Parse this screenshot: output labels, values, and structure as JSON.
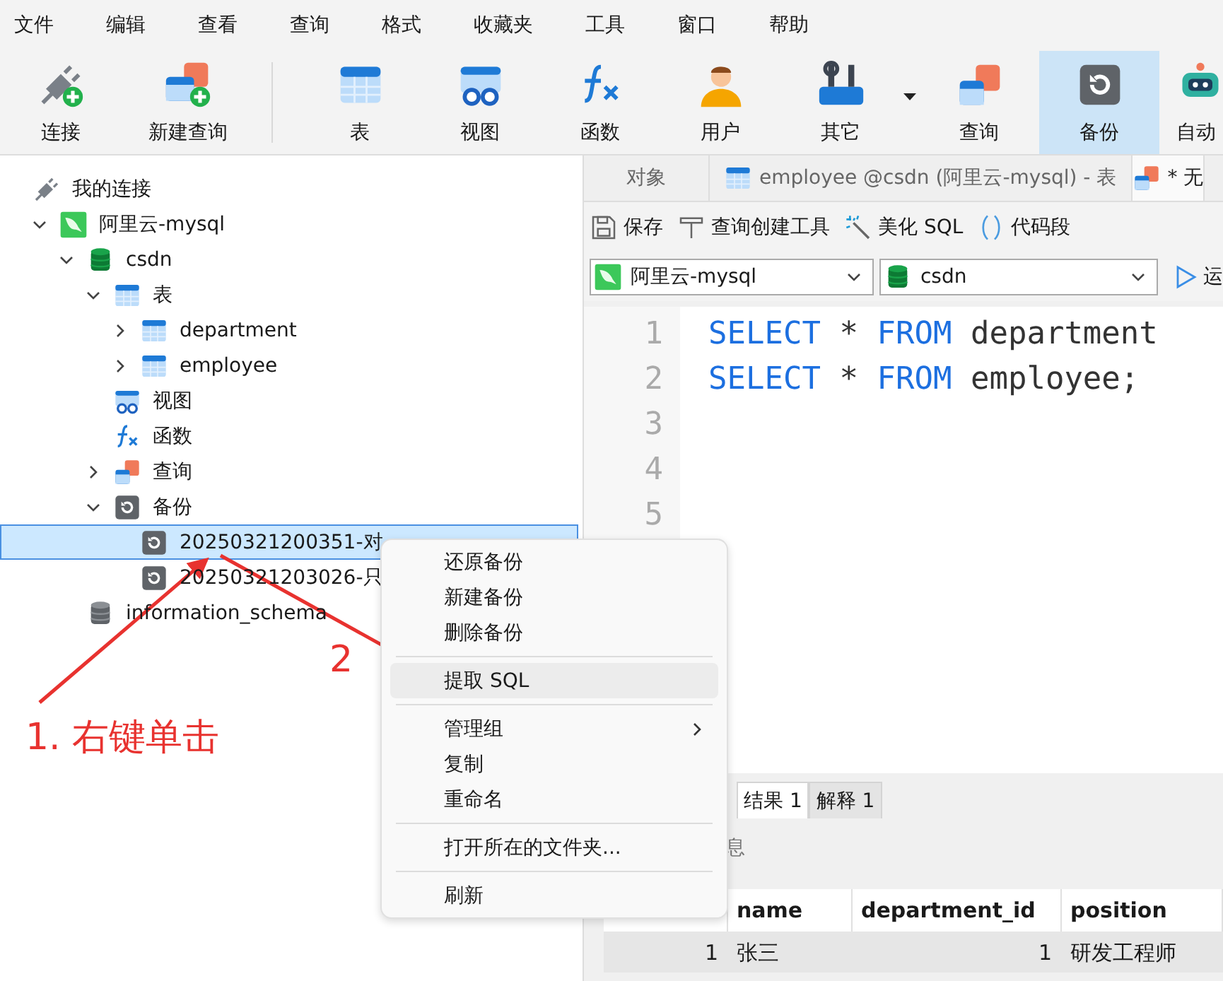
{
  "menu_bar": [
    "文件",
    "编辑",
    "查看",
    "查询",
    "格式",
    "收藏夹",
    "工具",
    "窗口",
    "帮助"
  ],
  "toolbar": [
    {
      "label": "连接",
      "kind": "plug",
      "selected": false
    },
    {
      "label": "新建查询",
      "kind": "newquery",
      "selected": false
    },
    {
      "label": "表",
      "kind": "table",
      "selected": false
    },
    {
      "label": "视图",
      "kind": "view",
      "selected": false
    },
    {
      "label": "函数",
      "kind": "function",
      "selected": false
    },
    {
      "label": "用户",
      "kind": "user",
      "selected": false
    },
    {
      "label": "其它",
      "kind": "tools",
      "selected": false,
      "dropdown": true
    },
    {
      "label": "查询",
      "kind": "query",
      "selected": false
    },
    {
      "label": "备份",
      "kind": "backup",
      "selected": true
    },
    {
      "label": "自动",
      "kind": "robot",
      "selected": false
    }
  ],
  "sidebar": {
    "root_label": "我的连接",
    "tree": [
      {
        "label": "阿里云-mysql",
        "kind": "mysql",
        "expanded": true,
        "selected": false,
        "children": [
          {
            "label": "csdn",
            "kind": "db",
            "expanded": true,
            "selected": false,
            "children": [
              {
                "label": "表",
                "kind": "table",
                "expanded": true,
                "selected": false,
                "children": [
                  {
                    "label": "department",
                    "kind": "table",
                    "expanded": false,
                    "selected": false
                  },
                  {
                    "label": "employee",
                    "kind": "table",
                    "expanded": false,
                    "selected": false
                  }
                ]
              },
              {
                "label": "视图",
                "kind": "view",
                "selected": false
              },
              {
                "label": "函数",
                "kind": "function",
                "selected": false
              },
              {
                "label": "查询",
                "kind": "query",
                "expanded": false,
                "selected": false
              },
              {
                "label": "备份",
                "kind": "backup",
                "expanded": true,
                "selected": false,
                "children": [
                  {
                    "label": "20250321200351-对",
                    "kind": "backup",
                    "selected": true
                  },
                  {
                    "label": "20250321203026-只",
                    "kind": "backup",
                    "selected": false
                  }
                ]
              }
            ]
          },
          {
            "label": "information_schema",
            "kind": "dbgrey",
            "selected": false
          }
        ]
      }
    ]
  },
  "tabs": [
    {
      "label": "对象",
      "kind": "plain",
      "selected": false
    },
    {
      "label": "employee @csdn (阿里云-mysql) - 表",
      "kind": "table",
      "selected": false
    },
    {
      "label": "* 无",
      "kind": "query",
      "selected": true
    }
  ],
  "editor_toolbar": [
    "保存",
    "查询创建工具",
    "美化 SQL",
    "代码段"
  ],
  "connection_select": "阿里云-mysql",
  "database_select": "csdn",
  "run_button": "运",
  "editor": {
    "line_numbers": [
      "1",
      "2",
      "3",
      "4",
      "5"
    ],
    "lines": [
      [
        {
          "text": "SELECT",
          "kind": "keyword"
        },
        {
          "text": " * ",
          "kind": "plain"
        },
        {
          "text": "FROM",
          "kind": "keyword"
        },
        {
          "text": " department",
          "kind": "plain"
        }
      ],
      [
        {
          "text": "SELECT",
          "kind": "keyword"
        },
        {
          "text": " * ",
          "kind": "plain"
        },
        {
          "text": "FROM",
          "kind": "keyword"
        },
        {
          "text": " employee;",
          "kind": "plain"
        }
      ]
    ]
  },
  "result_tabs": [
    {
      "label": "结果 1",
      "selected": true
    },
    {
      "label": "解释 1",
      "selected": false
    }
  ],
  "info_label": "息",
  "table": {
    "columns": [
      "",
      "name",
      "department_id",
      "position"
    ],
    "rows": [
      {
        "cells": [
          "1",
          "张三",
          "1",
          "研发工程师"
        ],
        "selected": true
      }
    ]
  },
  "context_menu": [
    {
      "kind": "item",
      "label": "还原备份",
      "selected": false
    },
    {
      "kind": "item",
      "label": "新建备份",
      "selected": false
    },
    {
      "kind": "item",
      "label": "删除备份",
      "selected": false
    },
    {
      "kind": "separator"
    },
    {
      "kind": "item",
      "label": "提取 SQL",
      "selected": true
    },
    {
      "kind": "separator"
    },
    {
      "kind": "item",
      "label": "管理组",
      "selected": false,
      "submenu": true
    },
    {
      "kind": "item",
      "label": "复制",
      "selected": false
    },
    {
      "kind": "item",
      "label": "重命名",
      "selected": false
    },
    {
      "kind": "separator"
    },
    {
      "kind": "item",
      "label": "打开所在的文件夹...",
      "selected": false
    },
    {
      "kind": "separator"
    },
    {
      "kind": "item",
      "label": "刷新",
      "selected": false
    }
  ],
  "annotations": [
    {
      "text": "1. 右键单击"
    },
    {
      "text": "2"
    }
  ]
}
